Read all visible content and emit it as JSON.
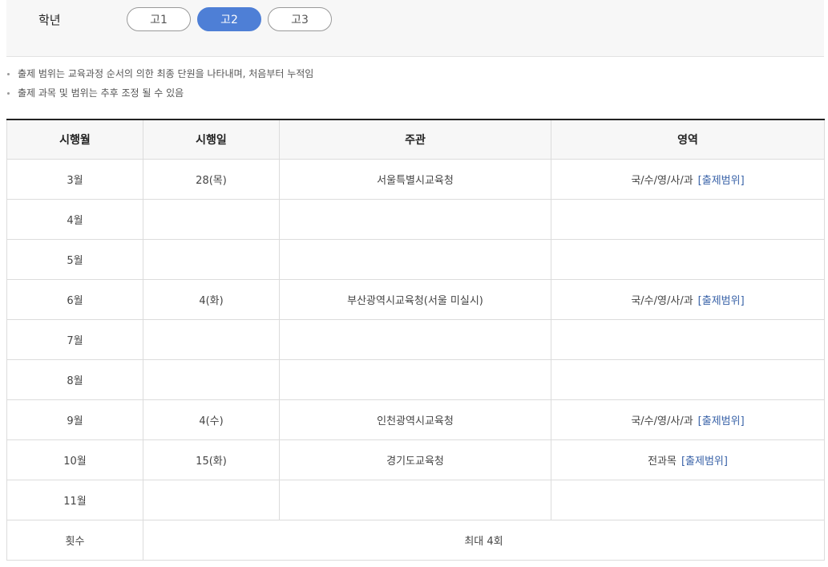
{
  "grade_selector": {
    "label": "학년",
    "options": [
      {
        "label": "고1",
        "active": false
      },
      {
        "label": "고2",
        "active": true
      },
      {
        "label": "고3",
        "active": false
      }
    ]
  },
  "notes": [
    "출제 범위는 교육과정 순서의 의한 최종 단원을 나타내며, 처음부터 누적임",
    "출제 과목 및 범위는 추후 조정 될 수 있음"
  ],
  "table": {
    "headers": [
      "시행월",
      "시행일",
      "주관",
      "영역"
    ],
    "rows": [
      {
        "month": "3월",
        "day": "28(목)",
        "host": "서울특별시교육청",
        "area": "국/수/영/사/과",
        "range": "[출제범위]"
      },
      {
        "month": "4월",
        "day": "",
        "host": "",
        "area": "",
        "range": ""
      },
      {
        "month": "5월",
        "day": "",
        "host": "",
        "area": "",
        "range": ""
      },
      {
        "month": "6월",
        "day": "4(화)",
        "host": "부산광역시교육청(서울 미실시)",
        "area": "국/수/영/사/과",
        "range": "[출제범위]"
      },
      {
        "month": "7월",
        "day": "",
        "host": "",
        "area": "",
        "range": ""
      },
      {
        "month": "8월",
        "day": "",
        "host": "",
        "area": "",
        "range": ""
      },
      {
        "month": "9월",
        "day": "4(수)",
        "host": "인천광역시교육청",
        "area": "국/수/영/사/과",
        "range": "[출제범위]"
      },
      {
        "month": "10월",
        "day": "15(화)",
        "host": "경기도교육청",
        "area": "전과목",
        "range": "[출제범위]"
      },
      {
        "month": "11월",
        "day": "",
        "host": "",
        "area": "",
        "range": ""
      }
    ],
    "footer": {
      "label": "횟수",
      "value": "최대 4회"
    }
  }
}
